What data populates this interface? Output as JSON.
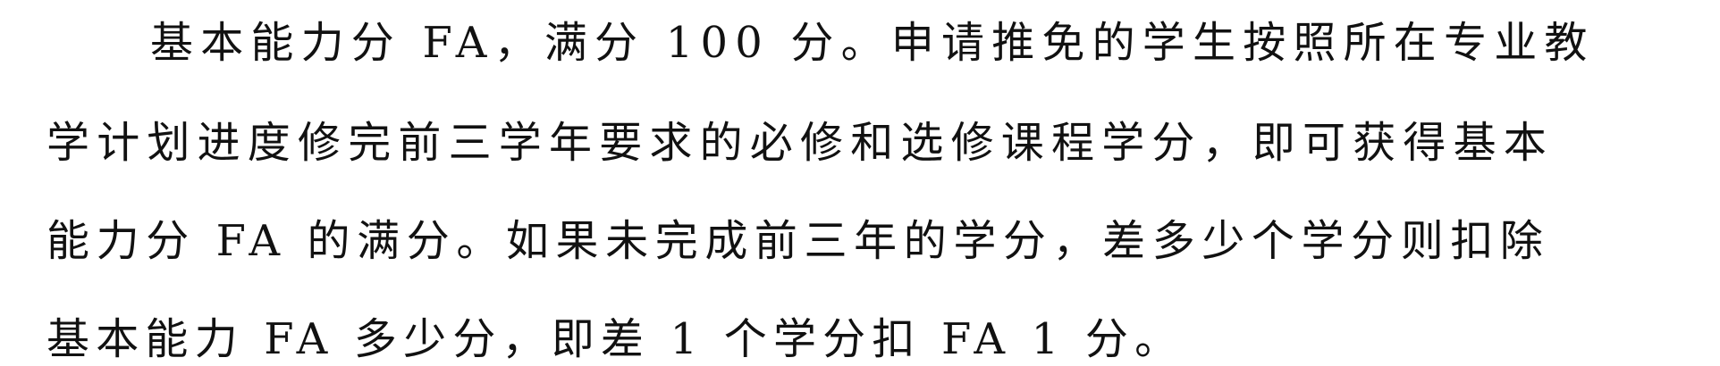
{
  "document": {
    "lines": [
      "基本能力分 FA，满分 100 分。申请推免的学生按照所在专业教",
      "学计划进度修完前三学年要求的必修和选修课程学分，即可获得基本",
      "能力分 FA 的满分。如果未完成前三年的学分，差多少个学分则扣除",
      "基本能力 FA 多少分，即差 1 个学分扣 FA 1 分。"
    ]
  }
}
